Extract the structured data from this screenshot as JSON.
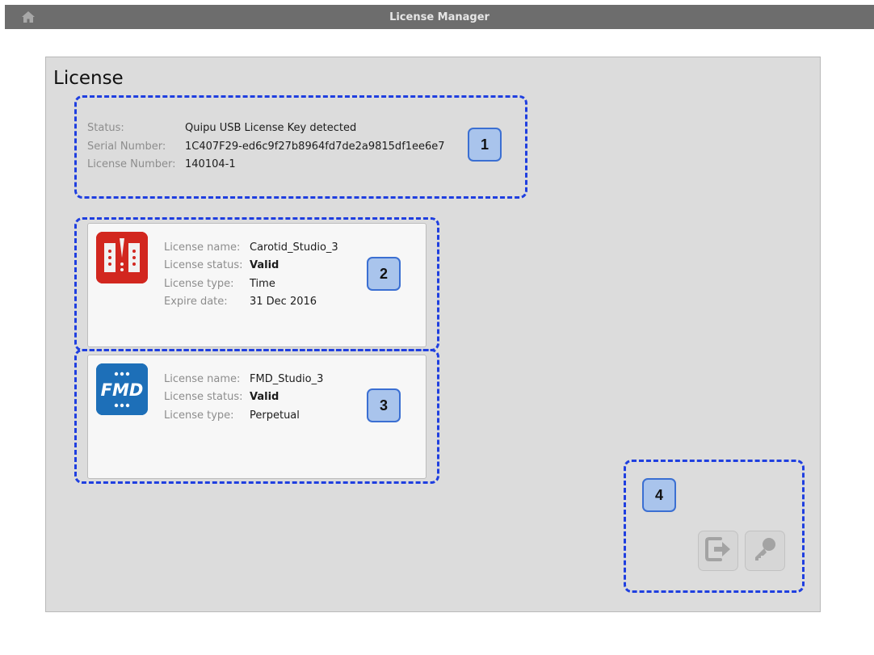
{
  "window": {
    "title": "License Manager",
    "home_icon": "home-icon"
  },
  "panel": {
    "title": "License"
  },
  "status_section": {
    "status_label": "Status:",
    "status_value": "Quipu USB License Key detected",
    "serial_label": "Serial Number:",
    "serial_value": "1C407F29-ed6c9f27b8964fd7de2a9815df1ee6e7",
    "license_number_label": "License Number:",
    "license_number_value": "140104-1"
  },
  "licenses": [
    {
      "icon": "carotid-studio-icon",
      "icon_color": "#d2271f",
      "name_label": "License name:",
      "name_value": "Carotid_Studio_3",
      "status_label": "License status:",
      "status_value": "Valid",
      "type_label": "License type:",
      "type_value": "Time",
      "expire_label": "Expire date:",
      "expire_value": "31 Dec 2016"
    },
    {
      "icon": "fmd-studio-icon",
      "icon_text": "FMD",
      "icon_color": "#1d6fb8",
      "name_label": "License name:",
      "name_value": "FMD_Studio_3",
      "status_label": "License status:",
      "status_value": "Valid",
      "type_label": "License type:",
      "type_value": "Perpetual"
    }
  ],
  "markers": [
    "1",
    "2",
    "3",
    "4"
  ],
  "toolbar": {
    "export_icon": "export-icon",
    "key_icon": "key-icon"
  },
  "colors": {
    "highlight": "#1f3fe0",
    "marker_fill": "#a9c4ec",
    "titlebar": "#6d6d6d",
    "panel": "#dcdcdc"
  }
}
